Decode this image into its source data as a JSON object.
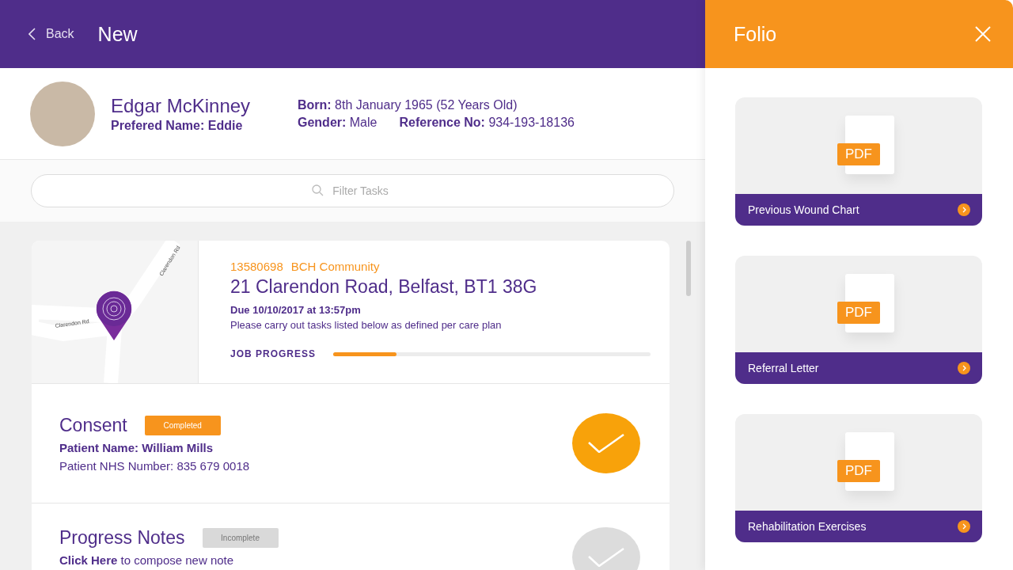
{
  "header": {
    "back": "Back",
    "title": "New"
  },
  "patient": {
    "name": "Edgar McKinney",
    "preferred": "Prefered Name: Eddie",
    "born": "**Born:** 8th January 1965 (52 Years Old)",
    "gender": "**Gender:** Male",
    "reference": "**Reference No:** 934-193-18136"
  },
  "filter": {
    "placeholder": "Filter Tasks"
  },
  "job": {
    "map_labels": [
      "Clarendon Rd",
      "Clarendon Rd"
    ],
    "number": "13580698",
    "organisation": "BCH Community",
    "address": "21 Clarendon Road, Belfast, BT1 38G",
    "due": "Due 10/10/2017 at 13:57pm",
    "instructions": "Please carry out tasks listed below as defined per care plan",
    "progress_label": "JOB PROGRESS",
    "level": 0.2
  },
  "tasks": [
    {
      "title": "Consent",
      "status": "Completed",
      "completed": true,
      "lines": [
        {
          "kind": "text",
          "bold": true,
          "text": "Patient Name: William Mills"
        },
        {
          "kind": "text",
          "bold": false,
          "text": "Patient NHS Number: 835 679 0018"
        }
      ]
    },
    {
      "title": "Progress Notes",
      "status": "Incomplete",
      "completed": false,
      "lines": [
        {
          "kind": "link",
          "link": "Click Here",
          "text": " to compose new note"
        }
      ]
    }
  ],
  "folio": {
    "title": "Folio",
    "documents": [
      {
        "badge": "PDF",
        "title": "Previous Wound Chart"
      },
      {
        "badge": "PDF",
        "title": "Referral Letter"
      },
      {
        "badge": "PDF",
        "title": "Rehabilitation Exercises"
      }
    ]
  }
}
